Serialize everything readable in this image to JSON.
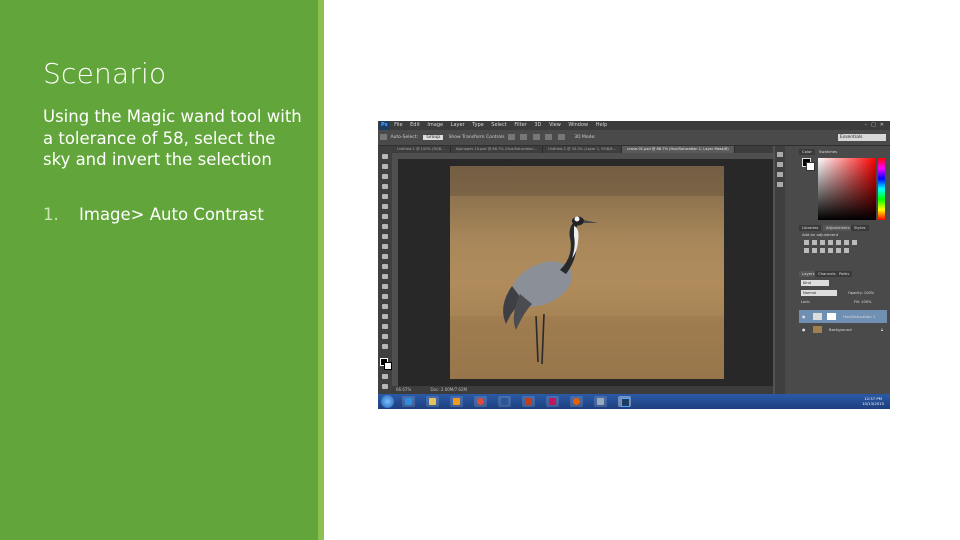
{
  "slide": {
    "title": "Scenario",
    "body": "Using the Magic wand tool with a tolerance of 58,  select the sky and invert the selection",
    "steps": [
      {
        "number": "1.",
        "text": "Image> Auto Contrast"
      }
    ],
    "colors": {
      "sidebar": "#62a63b",
      "sidebar_edge": "#8cc152",
      "text": "#ffffff"
    }
  },
  "screenshot": {
    "app_logo": "Ps",
    "menu": [
      "File",
      "Edit",
      "Image",
      "Layer",
      "Type",
      "Select",
      "Filter",
      "3D",
      "View",
      "Window",
      "Help"
    ],
    "options": {
      "auto_select": "Auto-Select:",
      "group": "Group",
      "transform": "Show Transform Controls",
      "mode": "3D Mode:",
      "workspace": "Essentials"
    },
    "doc_tabs": [
      "Untitled-1 @ 100% (RGB...",
      "Alpinepes 10.psd @ 66.7% (Hue/Saturation...",
      "Untitled-2 @ 33.3% (Layer 1, RGB/8...",
      "crane-01.psd @ 66.7% (Hue/Saturation 1, Layer Mask/8)"
    ],
    "active_tab_index": 3,
    "status": {
      "zoom": "66.67%",
      "doc": "Doc: 2.00M/7.62M"
    },
    "panels": {
      "color_tabs": [
        "Color",
        "Swatches"
      ],
      "adjust_tabs": [
        "Libraries",
        "Adjustments",
        "Styles"
      ],
      "adjust_label": "Add an adjustment",
      "layer_tabs": [
        "Layers",
        "Channels",
        "Paths"
      ],
      "kind": "Kind",
      "blend": "Normal",
      "opacity": "Opacity: 100%",
      "lock": "Lock:",
      "fill": "Fill: 100%",
      "layers": [
        {
          "name": "Hue/Saturation 1",
          "selected": true
        },
        {
          "name": "Background",
          "selected": false
        }
      ]
    },
    "taskbar": {
      "time": "12:37 PM",
      "date": "10/13/2015"
    }
  }
}
